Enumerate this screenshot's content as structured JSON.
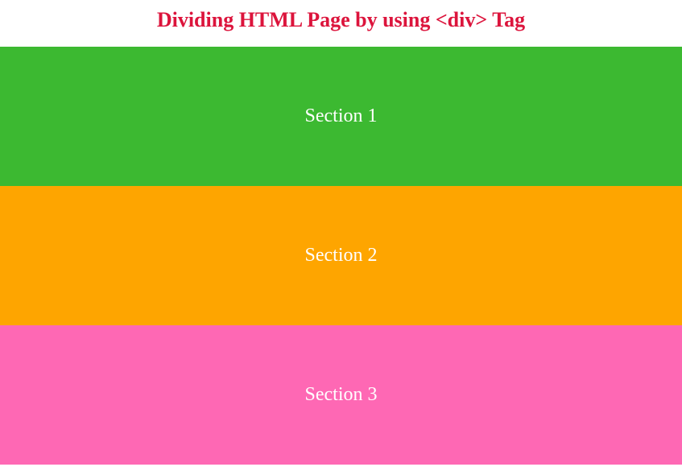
{
  "header": {
    "title": "Dividing HTML Page by using <div> Tag"
  },
  "sections": [
    {
      "label": "Section 1",
      "color": "#3cb931"
    },
    {
      "label": "Section 2",
      "color": "#fea500"
    },
    {
      "label": "Section 3",
      "color": "#fe68b4"
    }
  ]
}
